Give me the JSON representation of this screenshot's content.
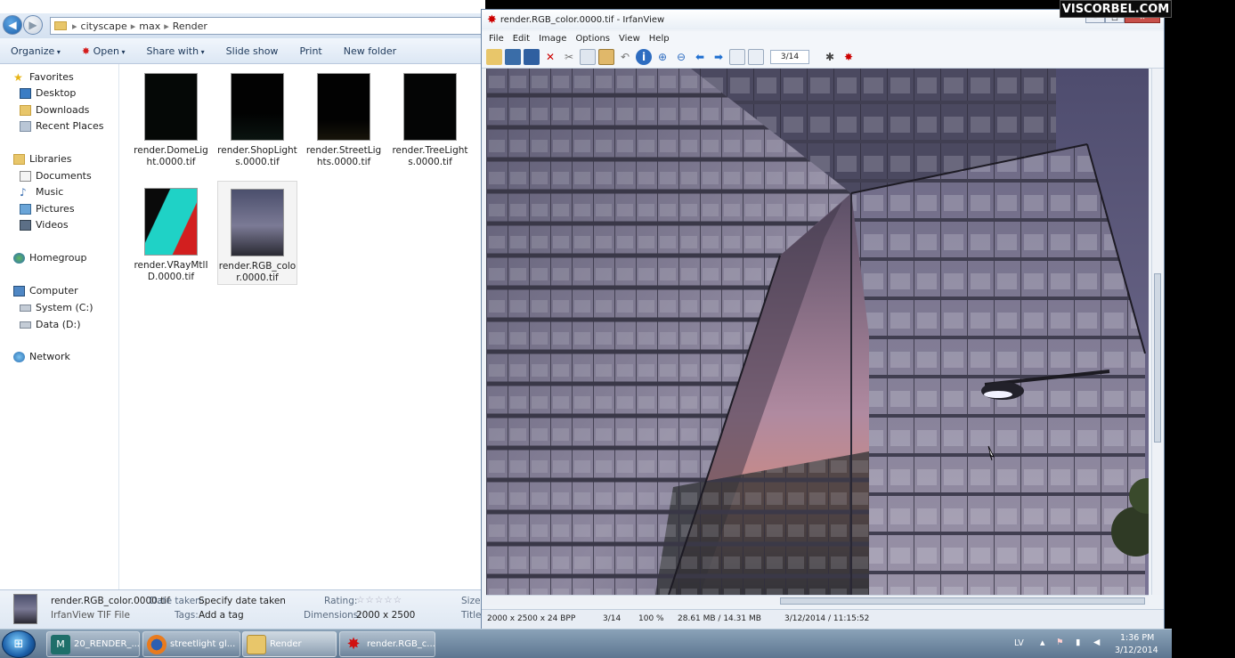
{
  "explorer": {
    "breadcrumb": [
      "cityscape",
      "max",
      "Render"
    ],
    "toolbar": {
      "organize": "Organize",
      "open": "Open",
      "share": "Share with",
      "slideshow": "Slide show",
      "print": "Print",
      "newfolder": "New folder"
    },
    "nav": [
      {
        "label": "Favorites",
        "icon": "star-icon"
      },
      {
        "label": "Desktop",
        "icon": "desktop-icon"
      },
      {
        "label": "Downloads",
        "icon": "downloads-icon"
      },
      {
        "label": "Recent Places",
        "icon": "recent-places-icon"
      },
      {
        "label": "Libraries",
        "icon": "libraries-icon"
      },
      {
        "label": "Documents",
        "icon": "documents-icon"
      },
      {
        "label": "Music",
        "icon": "music-icon"
      },
      {
        "label": "Pictures",
        "icon": "pictures-icon"
      },
      {
        "label": "Videos",
        "icon": "videos-icon"
      },
      {
        "label": "Homegroup",
        "icon": "homegroup-icon"
      },
      {
        "label": "Computer",
        "icon": "computer-icon"
      },
      {
        "label": "System (C:)",
        "icon": "drive-icon"
      },
      {
        "label": "Data (D:)",
        "icon": "drive-icon"
      },
      {
        "label": "Network",
        "icon": "network-icon"
      }
    ],
    "files": [
      {
        "name": "render.DomeLight.0000.tif"
      },
      {
        "name": "render.ShopLights.0000.tif"
      },
      {
        "name": "render.StreetLights.0000.tif"
      },
      {
        "name": "render.TreeLights.0000.tif"
      },
      {
        "name": "render.VRayMtlID.0000.tif"
      },
      {
        "name": "render.RGB_color.0000.tif"
      }
    ],
    "details": {
      "filename": "render.RGB_color.0000.tif",
      "filetype": "IrfanView TIF File",
      "date_label": "Date taken:",
      "date_value": "Specify date taken",
      "tags_label": "Tags:",
      "tags_value": "Add a tag",
      "rating_label": "Rating:",
      "dimensions_label": "Dimensions:",
      "dimensions_value": "2000 x 2500",
      "size_label": "Size:",
      "title_label": "Title:"
    }
  },
  "irfanview": {
    "title": "render.RGB_color.0000.tif - IrfanView",
    "menu": [
      "File",
      "Edit",
      "Image",
      "Options",
      "View",
      "Help"
    ],
    "page": "3/14",
    "status": {
      "dims": "2000 x 2500 x 24 BPP",
      "index": "3/14",
      "zoom": "100 %",
      "size": "28.61 MB / 14.31 MB",
      "datetime": "3/12/2014 / 11:15:52"
    }
  },
  "watermark": "VISCORBEL.COM",
  "taskbar": {
    "items": [
      {
        "label": "20_RENDER_...",
        "icon": "3dsmax-icon"
      },
      {
        "label": "streetlight gl...",
        "icon": "firefox-icon"
      },
      {
        "label": "Render",
        "icon": "folder-icon"
      },
      {
        "label": "render.RGB_c...",
        "icon": "irfanview-icon"
      }
    ],
    "lang": "LV",
    "time": "1:36 PM",
    "date": "3/12/2014"
  }
}
